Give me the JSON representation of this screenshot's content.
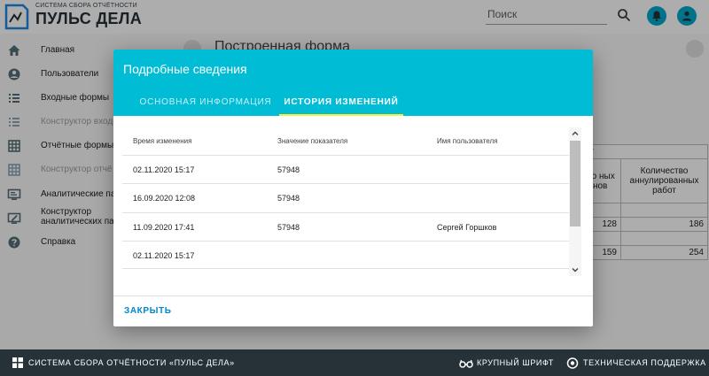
{
  "header": {
    "logo_sub": "СИСТЕМА СБОРА ОТЧЁТНОСТИ",
    "logo_main": "ПУЛЬС ДЕЛА",
    "search_placeholder": "Поиск",
    "accent": "#00aacc"
  },
  "sidebar": {
    "items": [
      {
        "label": "Главная",
        "icon": "home-icon",
        "dim": false
      },
      {
        "label": "Пользователи",
        "icon": "account-icon",
        "dim": false
      },
      {
        "label": "Входные формы",
        "icon": "list-icon",
        "dim": false
      },
      {
        "label": "Конструктор входн",
        "icon": "list-icon",
        "dim": true
      },
      {
        "label": "Отчётные формы",
        "icon": "grid-icon",
        "dim": false
      },
      {
        "label": "Конструктор отчё",
        "icon": "grid-icon",
        "dim": true
      },
      {
        "label": "Аналитические па",
        "icon": "monitor-icon",
        "dim": false
      },
      {
        "label": "Конструктор аналитических па",
        "icon": "monitor-edit-icon",
        "dim": false
      },
      {
        "label": "Справка",
        "icon": "help-icon",
        "dim": false
      }
    ]
  },
  "content": {
    "title": "Построенная форма",
    "table_fragments": {
      "city": "нбург",
      "col_a": "ество ных с енов",
      "col_b": "Количество аннулированных работ",
      "val_a1": "128",
      "val_b1": "186",
      "val_a2": "159",
      "val_b2": "254"
    }
  },
  "dialog": {
    "title": "Подробные сведения",
    "header_color": "#00bcd4",
    "tab_indicator_color": "#ffeb3b",
    "tabs": [
      {
        "label": "ОСНОВНАЯ ИНФОРМАЦИЯ",
        "active": false
      },
      {
        "label": "ИСТОРИЯ ИЗМЕНЕНИЙ",
        "active": true
      }
    ],
    "columns": [
      "Время изменения",
      "Значение показателя",
      "Имя пользователя"
    ],
    "rows": [
      {
        "time": "02.11.2020 15:17",
        "value": "57948",
        "user": ""
      },
      {
        "time": "16.09.2020 12:08",
        "value": "57948",
        "user": ""
      },
      {
        "time": "11.09.2020 17:41",
        "value": "57948",
        "user": "Сергей Горшков"
      },
      {
        "time": "02.11.2020 15:17",
        "value": "",
        "user": ""
      }
    ],
    "close_label": "ЗАКРЫТЬ",
    "close_color": "#0288d1"
  },
  "footer": {
    "system_text": "СИСТЕМА СБОРА ОТЧЁТНОСТИ «ПУЛЬС ДЕЛА»",
    "large_font": "КРУПНЫЙ ШРИФТ",
    "support": "ТЕХНИЧЕСКАЯ ПОДДЕРЖКА",
    "background": "#263238"
  }
}
